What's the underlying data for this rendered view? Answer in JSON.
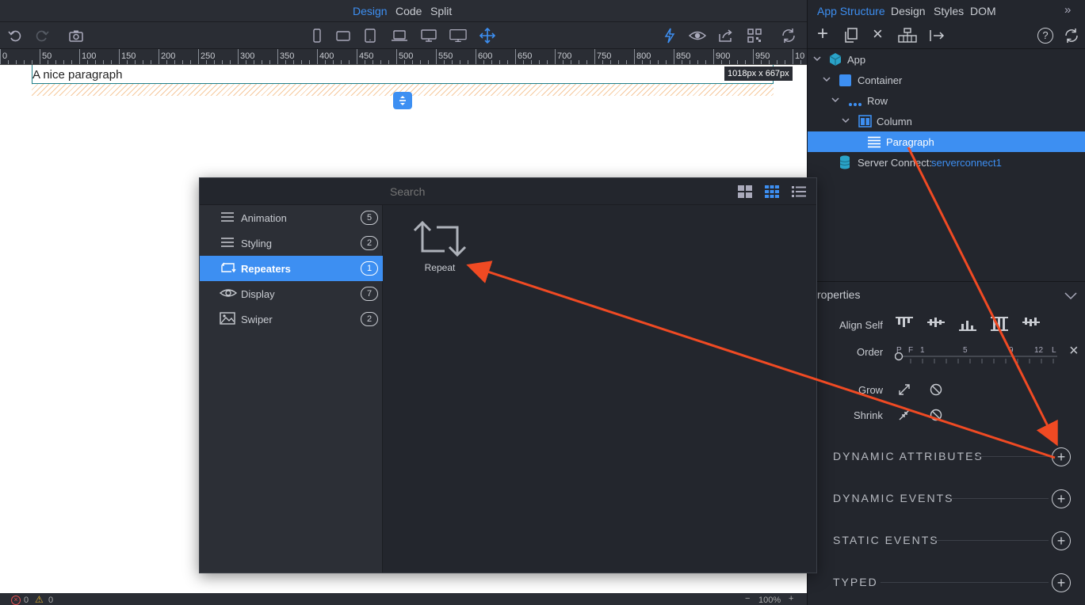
{
  "view_tabs": {
    "design": "Design",
    "code": "Code",
    "split": "Split",
    "active": "Design"
  },
  "ruler": {
    "ticks": [
      "0",
      "50",
      "100",
      "150",
      "200",
      "250",
      "300",
      "350",
      "400",
      "450",
      "500",
      "550",
      "600",
      "650",
      "700",
      "750",
      "800",
      "850",
      "900",
      "950",
      "10"
    ]
  },
  "canvas": {
    "paragraph_text": "A nice paragraph",
    "size_badge": "1018px x 667px"
  },
  "statusbar": {
    "errors": "0",
    "warnings": "0",
    "zoom": "100%"
  },
  "right_panel": {
    "tabs": {
      "app_structure": "App Structure",
      "design": "Design",
      "styles": "Styles",
      "dom": "DOM"
    },
    "tree": {
      "app": "App",
      "container": "Container",
      "row": "Row",
      "column": "Column",
      "paragraph": "Paragraph",
      "server_connect_label": "Server Connect:",
      "server_connect_name": "serverconnect1"
    },
    "properties": {
      "title": "roperties",
      "align_self": "Align Self",
      "order": "Order",
      "order_scale": [
        "F",
        "1",
        "5",
        "9",
        "12",
        "L"
      ],
      "order_first": "P",
      "grow": "Grow",
      "shrink": "Shrink"
    },
    "sections": [
      "DYNAMIC ATTRIBUTES",
      "DYNAMIC EVENTS",
      "STATIC EVENTS",
      "TYPED"
    ]
  },
  "picker": {
    "search_placeholder": "Search",
    "categories": [
      {
        "label": "Animation",
        "count": "5"
      },
      {
        "label": "Styling",
        "count": "2"
      },
      {
        "label": "Repeaters",
        "count": "1"
      },
      {
        "label": "Display",
        "count": "7"
      },
      {
        "label": "Swiper",
        "count": "2"
      }
    ],
    "items": [
      {
        "label": "Repeat"
      }
    ]
  },
  "colors": {
    "accent": "#3d8ff2",
    "arrow": "#f04a23",
    "selection": "#3d8ff2"
  }
}
